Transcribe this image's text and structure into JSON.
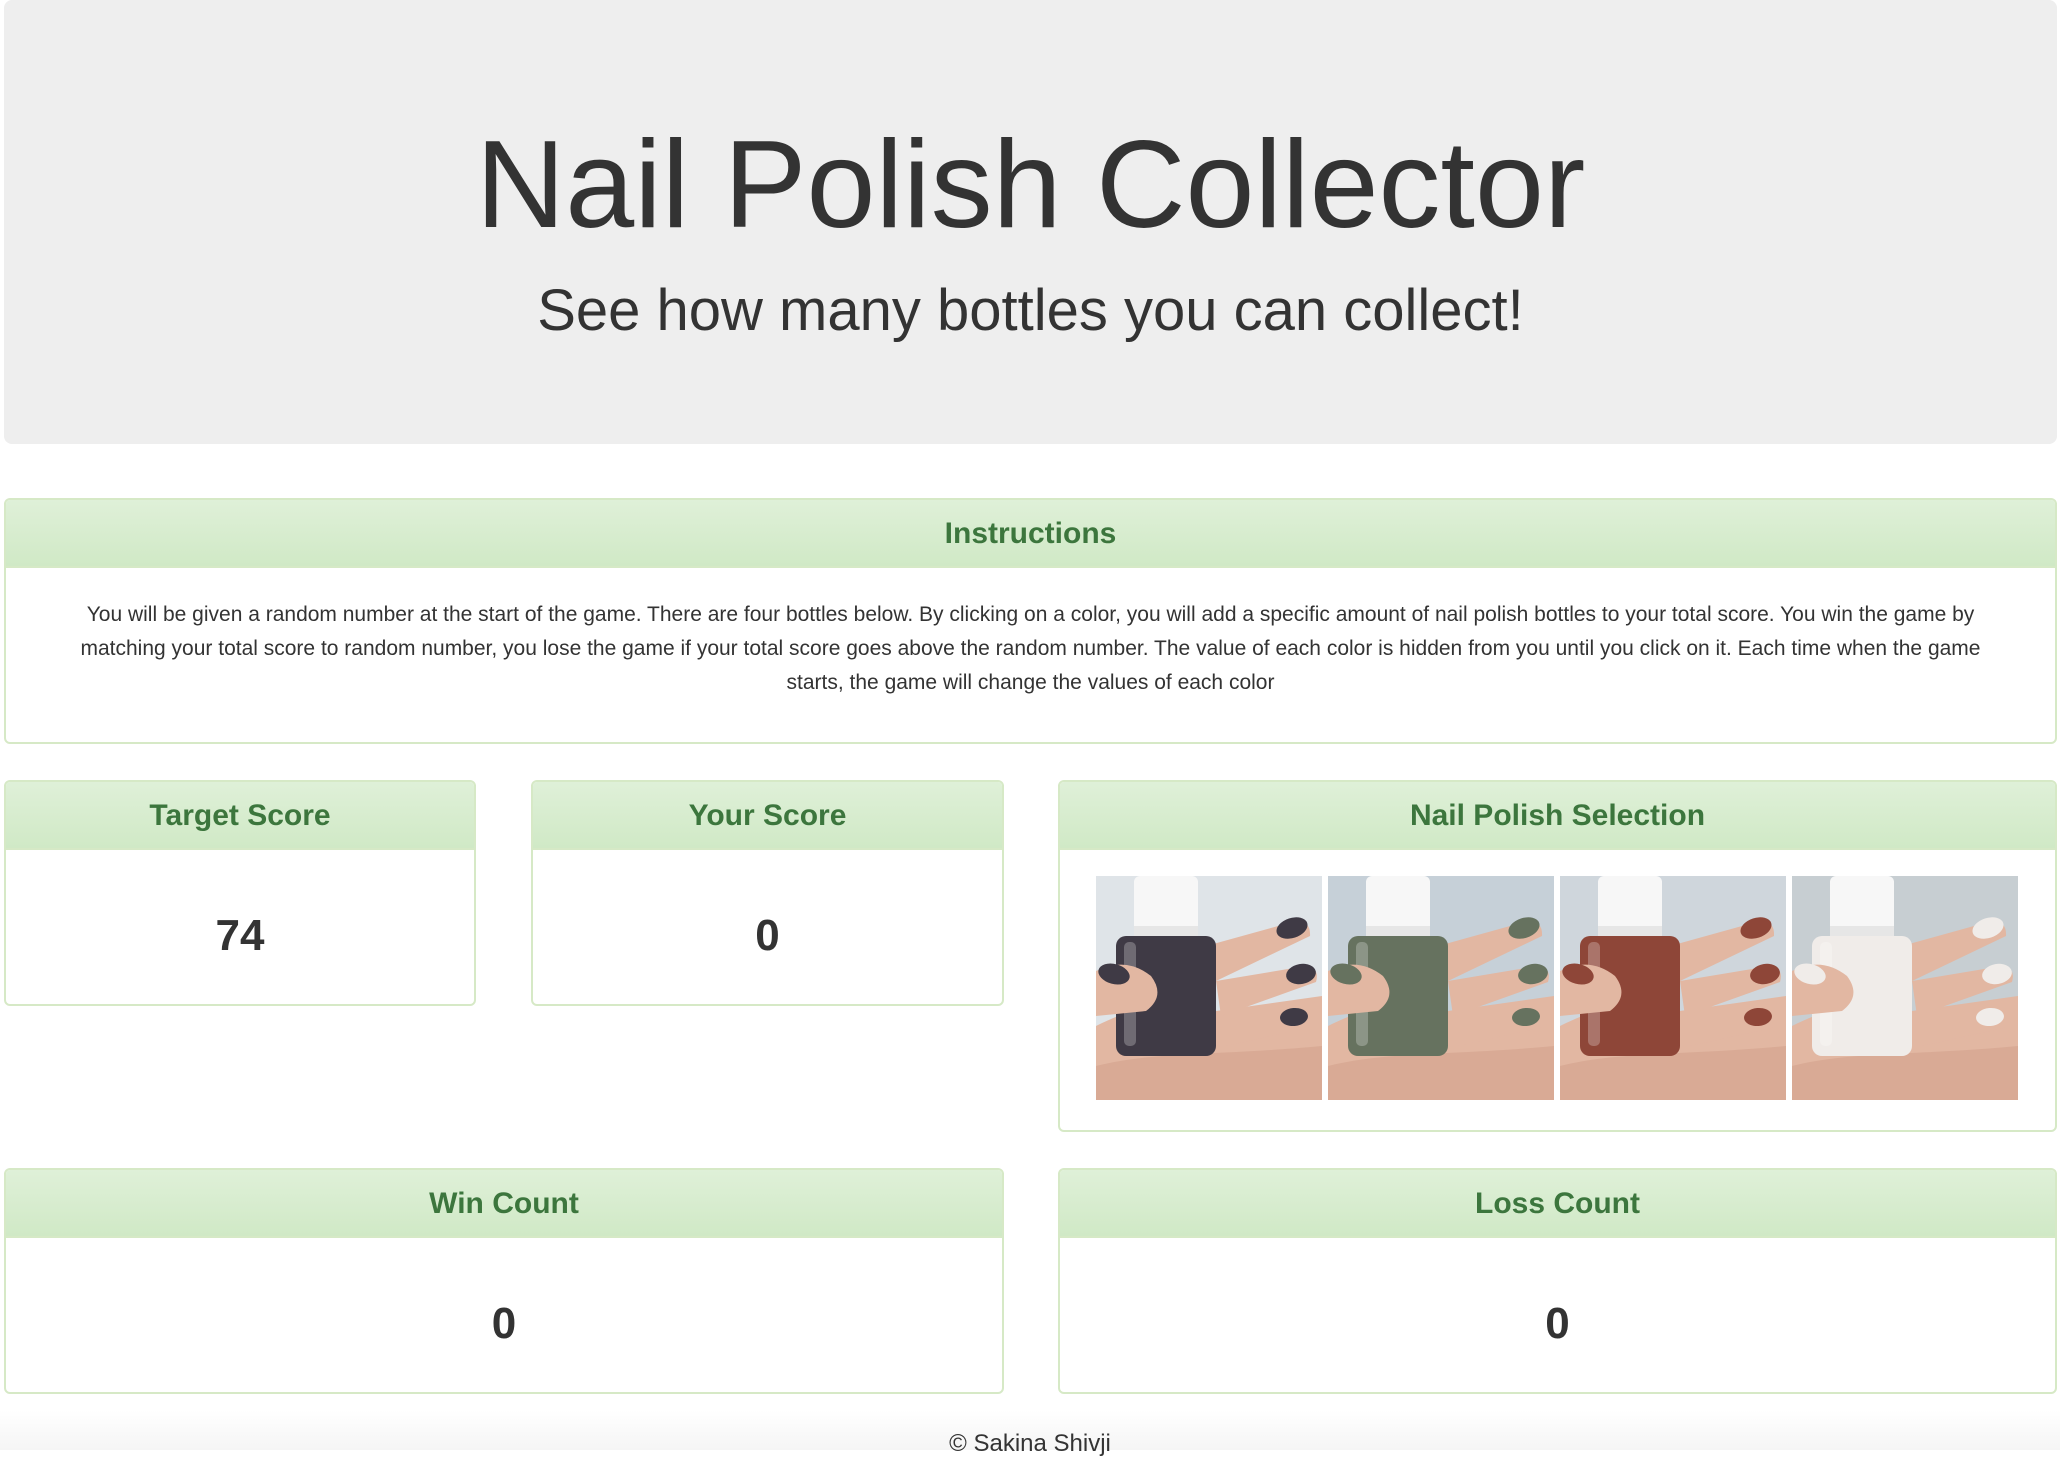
{
  "header": {
    "title": "Nail Polish Collector",
    "subtitle": "See how many bottles you can collect!"
  },
  "instructions": {
    "heading": "Instructions",
    "text": "You will be given a random number at the start of the game. There are four bottles below. By clicking on a color, you will add a specific amount of nail polish bottles to your total score. You win the game by matching your total score to random number, you lose the game if your total score goes above the random number. The value of each color is hidden from you until you click on it. Each time when the game starts, the game will change the values of each color"
  },
  "target_score": {
    "heading": "Target Score",
    "value": "74"
  },
  "your_score": {
    "heading": "Your Score",
    "value": "0"
  },
  "selection": {
    "heading": "Nail Polish Selection",
    "polishes": [
      {
        "name": "dark-plum",
        "color": "#3f3a45",
        "bg": "#dfe4e8"
      },
      {
        "name": "sage-green",
        "color": "#66725f",
        "bg": "#c6d0d8"
      },
      {
        "name": "brick-red",
        "color": "#8e4638",
        "bg": "#cfd6dc"
      },
      {
        "name": "white",
        "color": "#f0ece9",
        "bg": "#c7ced2"
      }
    ]
  },
  "win_count": {
    "heading": "Win Count",
    "value": "0"
  },
  "loss_count": {
    "heading": "Loss Count",
    "value": "0"
  },
  "footer": {
    "text": "© Sakina Shivji"
  },
  "colors": {
    "panel_heading_text": "#3c763d",
    "panel_border": "#d6e9c6",
    "jumbotron_bg": "#eeeeee"
  }
}
